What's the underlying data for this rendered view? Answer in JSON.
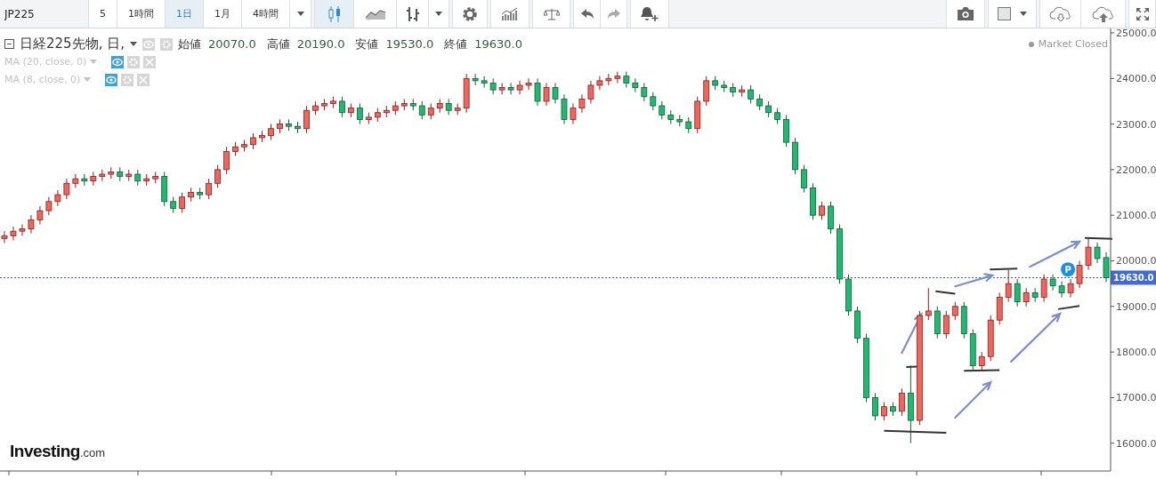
{
  "toolbar": {
    "symbol": "JP225",
    "intervals": [
      {
        "label": "5",
        "selected": false
      },
      {
        "label": "1時間",
        "selected": false
      },
      {
        "label": "1日",
        "selected": true
      },
      {
        "label": "1月",
        "selected": false
      },
      {
        "label": "4時間",
        "selected": false
      }
    ],
    "chart_types": [
      {
        "kind": "candles",
        "selected": true
      },
      {
        "kind": "area",
        "selected": false
      },
      {
        "kind": "bars",
        "selected": false
      }
    ]
  },
  "legend": {
    "title": "日経225先物, 日,",
    "values": [
      {
        "label": "始値",
        "value": "20070.0"
      },
      {
        "label": "高値",
        "value": "20190.0"
      },
      {
        "label": "安値",
        "value": "19530.0"
      },
      {
        "label": "終値",
        "value": "19630.0"
      }
    ]
  },
  "indicators": [
    {
      "label": "MA (20, close, 0)"
    },
    {
      "label": "MA (8, close, 0)"
    }
  ],
  "market_status": "Market Closed",
  "marker_label": "P",
  "last_price": "19630.0",
  "brand": {
    "name": "Investing",
    "suffix": ".com"
  },
  "chart_data": {
    "type": "candlestick",
    "ylim": [
      15390,
      25097
    ],
    "categories": [
      null,
      null,
      null,
      null,
      null,
      null,
      null,
      null,
      null,
      null,
      null,
      null,
      null,
      null,
      null,
      null,
      null,
      null,
      null,
      null,
      null,
      null,
      null,
      null,
      null,
      null,
      null,
      null,
      null,
      null,
      null,
      null,
      null,
      null,
      null,
      null,
      null,
      null,
      null,
      null,
      null,
      null,
      null,
      null,
      null,
      null,
      null,
      null,
      null,
      null,
      null,
      null,
      null,
      null,
      null,
      null,
      null,
      null,
      null,
      null,
      null,
      null,
      null,
      null,
      null,
      null,
      null,
      null,
      null,
      null,
      null,
      null,
      null,
      null,
      null,
      null,
      null,
      null,
      null,
      null,
      null,
      null,
      null,
      null,
      null,
      null,
      null,
      null,
      null,
      null,
      null,
      null,
      null,
      null,
      null,
      null,
      null,
      null,
      null,
      null,
      null,
      null,
      null,
      null,
      null,
      null,
      null,
      null,
      null,
      null,
      null,
      null,
      null,
      null,
      null,
      null,
      null,
      null,
      null,
      null,
      null,
      null,
      null,
      null,
      null
    ],
    "yticks": [
      {
        "value": 16000,
        "label": "16000.0"
      },
      {
        "value": 17000,
        "label": "17000.0"
      },
      {
        "value": 18000,
        "label": "18000.0"
      },
      {
        "value": 19000,
        "label": "19000.0"
      },
      {
        "value": 20000,
        "label": "20000.0"
      },
      {
        "value": 21000,
        "label": "21000.0"
      },
      {
        "value": 22000,
        "label": "22000.0"
      },
      {
        "value": 23000,
        "label": "23000.0"
      },
      {
        "value": 24000,
        "label": "24000.0"
      },
      {
        "value": 25000,
        "label": "25000.0"
      }
    ],
    "ohlc": [
      [
        20490,
        20650,
        20390,
        20550
      ],
      [
        20550,
        20750,
        20450,
        20650
      ],
      [
        20650,
        20800,
        20550,
        20700
      ],
      [
        20700,
        21000,
        20600,
        20900
      ],
      [
        20900,
        21200,
        20800,
        21100
      ],
      [
        21100,
        21400,
        21000,
        21300
      ],
      [
        21300,
        21550,
        21200,
        21450
      ],
      [
        21450,
        21800,
        21350,
        21700
      ],
      [
        21700,
        21900,
        21600,
        21800
      ],
      [
        21800,
        21900,
        21650,
        21750
      ],
      [
        21750,
        21950,
        21650,
        21850
      ],
      [
        21850,
        22000,
        21750,
        21900
      ],
      [
        21900,
        22050,
        21800,
        21950
      ],
      [
        21950,
        22050,
        21750,
        21850
      ],
      [
        21850,
        22000,
        21750,
        21900
      ],
      [
        21900,
        22000,
        21650,
        21750
      ],
      [
        21750,
        21900,
        21650,
        21800
      ],
      [
        21800,
        21950,
        21700,
        21850
      ],
      [
        21850,
        21950,
        21200,
        21300
      ],
      [
        21300,
        21400,
        21050,
        21150
      ],
      [
        21150,
        21500,
        21050,
        21400
      ],
      [
        21400,
        21600,
        21300,
        21500
      ],
      [
        21500,
        21600,
        21350,
        21450
      ],
      [
        21450,
        21800,
        21350,
        21700
      ],
      [
        21700,
        22100,
        21600,
        22000
      ],
      [
        22000,
        22500,
        21900,
        22400
      ],
      [
        22400,
        22600,
        22300,
        22500
      ],
      [
        22500,
        22650,
        22400,
        22550
      ],
      [
        22550,
        22800,
        22450,
        22700
      ],
      [
        22700,
        22850,
        22600,
        22750
      ],
      [
        22750,
        23000,
        22650,
        22900
      ],
      [
        22900,
        23100,
        22800,
        23000
      ],
      [
        23000,
        23100,
        22850,
        22950
      ],
      [
        22950,
        23050,
        22800,
        22900
      ],
      [
        22900,
        23400,
        22800,
        23300
      ],
      [
        23300,
        23500,
        23200,
        23400
      ],
      [
        23400,
        23550,
        23300,
        23450
      ],
      [
        23450,
        23600,
        23350,
        23500
      ],
      [
        23500,
        23600,
        23150,
        23250
      ],
      [
        23250,
        23450,
        23150,
        23350
      ],
      [
        23350,
        23450,
        23000,
        23100
      ],
      [
        23100,
        23250,
        23000,
        23150
      ],
      [
        23150,
        23350,
        23050,
        23250
      ],
      [
        23250,
        23400,
        23150,
        23300
      ],
      [
        23300,
        23500,
        23200,
        23400
      ],
      [
        23400,
        23550,
        23300,
        23450
      ],
      [
        23450,
        23550,
        23300,
        23400
      ],
      [
        23400,
        23500,
        23100,
        23200
      ],
      [
        23200,
        23450,
        23100,
        23350
      ],
      [
        23350,
        23550,
        23250,
        23450
      ],
      [
        23450,
        23550,
        23200,
        23300
      ],
      [
        23300,
        23450,
        23200,
        23350
      ],
      [
        23350,
        24100,
        23250,
        24000
      ],
      [
        24000,
        24100,
        23850,
        23950
      ],
      [
        23950,
        24050,
        23800,
        23900
      ],
      [
        23900,
        24000,
        23650,
        23750
      ],
      [
        23750,
        23900,
        23650,
        23800
      ],
      [
        23800,
        23900,
        23650,
        23750
      ],
      [
        23750,
        23950,
        23650,
        23850
      ],
      [
        23850,
        24000,
        23750,
        23900
      ],
      [
        23900,
        24000,
        23400,
        23500
      ],
      [
        23500,
        23900,
        23400,
        23800
      ],
      [
        23800,
        23900,
        23450,
        23550
      ],
      [
        23550,
        23650,
        23000,
        23100
      ],
      [
        23100,
        23450,
        23000,
        23350
      ],
      [
        23350,
        23650,
        23250,
        23550
      ],
      [
        23550,
        23950,
        23450,
        23850
      ],
      [
        23850,
        24050,
        23750,
        23950
      ],
      [
        23950,
        24100,
        23850,
        24000
      ],
      [
        24000,
        24150,
        23900,
        24050
      ],
      [
        24050,
        24150,
        23800,
        23900
      ],
      [
        23900,
        24000,
        23700,
        23800
      ],
      [
        23800,
        23900,
        23500,
        23600
      ],
      [
        23600,
        23700,
        23300,
        23400
      ],
      [
        23400,
        23500,
        23100,
        23200
      ],
      [
        23200,
        23300,
        23000,
        23100
      ],
      [
        23100,
        23200,
        22950,
        23050
      ],
      [
        23050,
        23150,
        22800,
        22900
      ],
      [
        22900,
        23600,
        22800,
        23500
      ],
      [
        23500,
        24050,
        23400,
        23950
      ],
      [
        23950,
        24050,
        23750,
        23850
      ],
      [
        23850,
        23950,
        23700,
        23800
      ],
      [
        23800,
        23900,
        23600,
        23700
      ],
      [
        23700,
        23850,
        23600,
        23750
      ],
      [
        23750,
        23850,
        23450,
        23550
      ],
      [
        23550,
        23650,
        23300,
        23400
      ],
      [
        23400,
        23500,
        23150,
        23250
      ],
      [
        23250,
        23350,
        23000,
        23100
      ],
      [
        23100,
        23200,
        22500,
        22600
      ],
      [
        22600,
        22700,
        21900,
        22000
      ],
      [
        22000,
        22100,
        21500,
        21600
      ],
      [
        21600,
        21700,
        20900,
        21000
      ],
      [
        21000,
        21300,
        20900,
        21200
      ],
      [
        21200,
        21300,
        20600,
        20700
      ],
      [
        20700,
        20800,
        19500,
        19600
      ],
      [
        19600,
        19700,
        18800,
        18900
      ],
      [
        18900,
        19000,
        18200,
        18300
      ],
      [
        18300,
        18400,
        16900,
        17000
      ],
      [
        17000,
        17100,
        16500,
        16600
      ],
      [
        16600,
        16900,
        16500,
        16800
      ],
      [
        16800,
        16900,
        16600,
        16700
      ],
      [
        16700,
        17200,
        16600,
        17100
      ],
      [
        17100,
        17700,
        16000,
        16500
      ],
      [
        16500,
        18900,
        16400,
        18800
      ],
      [
        18800,
        19400,
        18700,
        18900
      ],
      [
        18900,
        19000,
        18300,
        18400
      ],
      [
        18400,
        18900,
        18300,
        18800
      ],
      [
        18800,
        19100,
        18700,
        19000
      ],
      [
        19000,
        19100,
        18300,
        18400
      ],
      [
        18400,
        18500,
        17600,
        17700
      ],
      [
        17700,
        18000,
        17600,
        17900
      ],
      [
        17900,
        18800,
        17800,
        18700
      ],
      [
        18700,
        19300,
        18600,
        19200
      ],
      [
        19200,
        19800,
        19100,
        19500
      ],
      [
        19500,
        19600,
        19000,
        19100
      ],
      [
        19100,
        19400,
        19000,
        19300
      ],
      [
        19300,
        19400,
        19100,
        19200
      ],
      [
        19200,
        19700,
        19100,
        19600
      ],
      [
        19600,
        19700,
        19350,
        19450
      ],
      [
        19450,
        19550,
        19200,
        19300
      ],
      [
        19300,
        19600,
        19200,
        19500
      ],
      [
        19500,
        20000,
        19400,
        19900
      ],
      [
        19900,
        20500,
        19800,
        20300
      ],
      [
        20300,
        20400,
        19950,
        20050
      ],
      [
        20070,
        20190,
        19530,
        19630
      ]
    ]
  }
}
